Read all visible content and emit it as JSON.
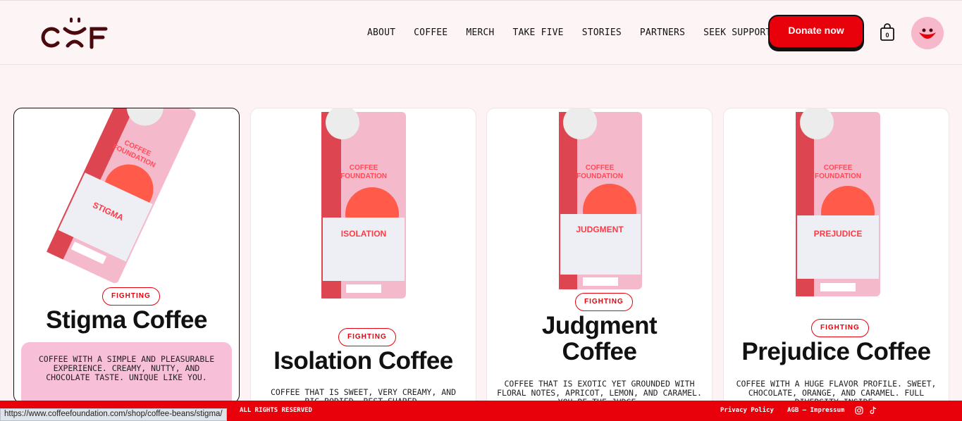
{
  "header": {
    "logo_text": "CF",
    "nav": [
      "ABOUT",
      "COFFEE",
      "MERCH",
      "TAKE FIVE",
      "STORIES",
      "PARTNERS",
      "SEEK SUPPORT"
    ],
    "donate_label": "Donate now",
    "cart_count": "0"
  },
  "products": [
    {
      "tag": "FIGHTING",
      "title": "Stigma Coffee",
      "bag_label": "STIGMA",
      "description": "COFFEE WITH A SIMPLE AND PLEASURABLE EXPERIENCE. CREAMY, NUTTY, AND CHOCOLATE TASTE. UNIQUE LIKE YOU."
    },
    {
      "tag": "FIGHTING",
      "title": "Isolation Coffee",
      "bag_label": "ISOLATION",
      "description": "COFFEE THAT IS SWEET, VERY CREAMY, AND BIG-BODIED. BEST SHARED."
    },
    {
      "tag": "FIGHTING",
      "title_line1": "Judgment",
      "title_line2": "Coffee",
      "bag_label": "JUDGMENT",
      "description": "COFFEE THAT IS EXOTIC YET GROUNDED WITH FLORAL NOTES, APRICOT, LEMON, AND CARAMEL. YOU BE THE JUDGE."
    },
    {
      "tag": "FIGHTING",
      "title": "Prejudice Coffee",
      "bag_label": "PREJUDICE",
      "description": "COFFEE WITH A HUGE FLAVOR PROFILE. SWEET, CHOCOLATE, ORANGE, AND CARAMEL. FULL DIVERSITY INSIDE."
    }
  ],
  "bag_brand_line1": "COFFEE",
  "bag_brand_line2": "FOUNDATION",
  "footer": {
    "rights": "ALL RIGHTS RESERVED",
    "privacy": "Privacy Policy",
    "agb": "AGB – Impressum"
  },
  "status_url": "https://www.coffeefoundation.com/shop/coffee-beans/stigma/",
  "colors": {
    "brand_red": "#e8000b",
    "bag_pink": "#f5b9cc",
    "logo_maroon": "#4a0a0d"
  }
}
